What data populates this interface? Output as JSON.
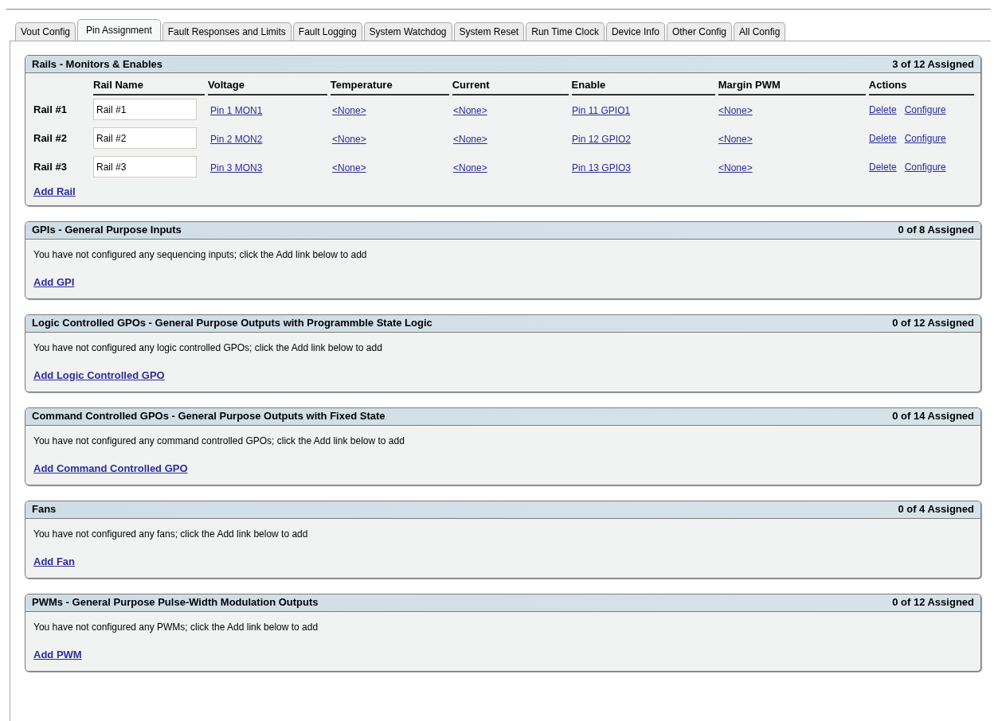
{
  "tabs": [
    {
      "label": "Vout Config",
      "selected": false
    },
    {
      "label": "Pin Assignment",
      "selected": true
    },
    {
      "label": "Fault Responses and Limits",
      "selected": false
    },
    {
      "label": "Fault Logging",
      "selected": false
    },
    {
      "label": "System Watchdog",
      "selected": false
    },
    {
      "label": "System Reset",
      "selected": false
    },
    {
      "label": "Run Time Clock",
      "selected": false
    },
    {
      "label": "Device Info",
      "selected": false
    },
    {
      "label": "Other Config",
      "selected": false
    },
    {
      "label": "All Config",
      "selected": false
    }
  ],
  "rails": {
    "title": "Rails - Monitors & Enables",
    "count": "3 of 12 Assigned",
    "columns": [
      "Rail Name",
      "Voltage",
      "Temperature",
      "Current",
      "Enable",
      "Margin PWM",
      "Actions"
    ],
    "rows": [
      {
        "label": "Rail #1",
        "name": "Rail #1",
        "voltage": "Pin 1 MON1",
        "temperature": "<None>",
        "current": "<None>",
        "enable": "Pin 11 GPIO1",
        "margin_pwm": "<None>",
        "actions": [
          "Delete",
          "Configure"
        ]
      },
      {
        "label": "Rail #2",
        "name": "Rail #2",
        "voltage": "Pin 2 MON2",
        "temperature": "<None>",
        "current": "<None>",
        "enable": "Pin 12 GPIO2",
        "margin_pwm": "<None>",
        "actions": [
          "Delete",
          "Configure"
        ]
      },
      {
        "label": "Rail #3",
        "name": "Rail #3",
        "voltage": "Pin 3 MON3",
        "temperature": "<None>",
        "current": "<None>",
        "enable": "Pin 13 GPIO3",
        "margin_pwm": "<None>",
        "actions": [
          "Delete",
          "Configure"
        ]
      }
    ],
    "add_link": "Add Rail"
  },
  "sections": [
    {
      "title": "GPIs - General Purpose Inputs",
      "count": "0 of 8 Assigned",
      "message": "You have not configured any sequencing inputs; click the Add link below to add",
      "add_link": "Add GPI"
    },
    {
      "title": "Logic Controlled GPOs - General Purpose Outputs with Programmble State Logic",
      "count": "0 of 12 Assigned",
      "message": "You have not configured any logic controlled GPOs; click the Add link below to add",
      "add_link": "Add Logic Controlled GPO"
    },
    {
      "title": "Command Controlled GPOs - General Purpose Outputs with Fixed State",
      "count": "0 of 14 Assigned",
      "message": "You have not configured any command controlled GPOs; click the Add link below to add",
      "add_link": "Add Command Controlled GPO"
    },
    {
      "title": "Fans",
      "count": "0 of 4 Assigned",
      "message": "You have not configured any fans; click the Add link below to add",
      "add_link": "Add Fan"
    },
    {
      "title": "PWMs - General Purpose Pulse-Width Modulation Outputs",
      "count": "0 of 12 Assigned",
      "message": "You have not configured any PWMs; click the Add link below to add",
      "add_link": "Add PWM"
    }
  ]
}
